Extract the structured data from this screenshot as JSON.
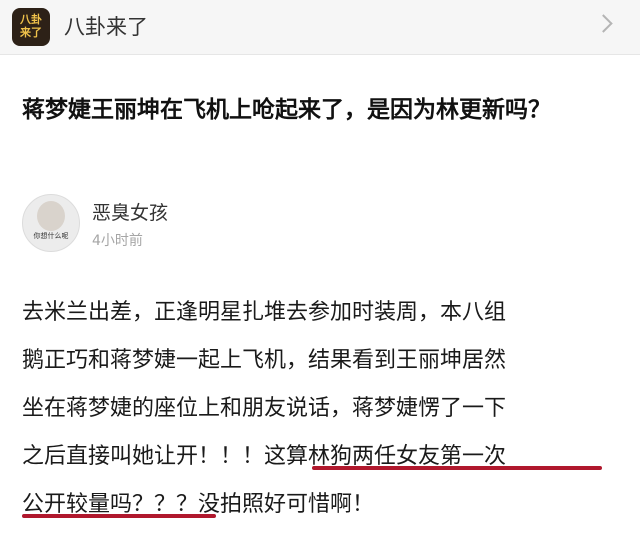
{
  "header": {
    "avatar_text_line1": "八卦",
    "avatar_text_line2": "来了",
    "title": "八卦来了",
    "chevron_icon": "chevron-right-icon"
  },
  "post": {
    "headline": "蒋梦婕王丽坤在飞机上呛起来了，是因为林更新吗？",
    "author": {
      "name": "恶臭女孩",
      "time": "4小时前",
      "avatar_caption": "你想什么呢"
    },
    "body_lines": [
      "去米兰出差，正逢明星扎堆去参加时装周，本八组",
      "鹅正巧和蒋梦婕一起上飞机，结果看到王丽坤居然",
      "坐在蒋梦婕的座位上和朋友说话，蒋梦婕愣了一下",
      "之后直接叫她让开！！！这算林狗两任女友第一次",
      "公开较量吗？？？没拍照好可惜啊！"
    ]
  },
  "colors": {
    "underline": "#b0182d",
    "topbar_bg": "#f6f6f6",
    "muted_text": "#a6a6a6"
  }
}
